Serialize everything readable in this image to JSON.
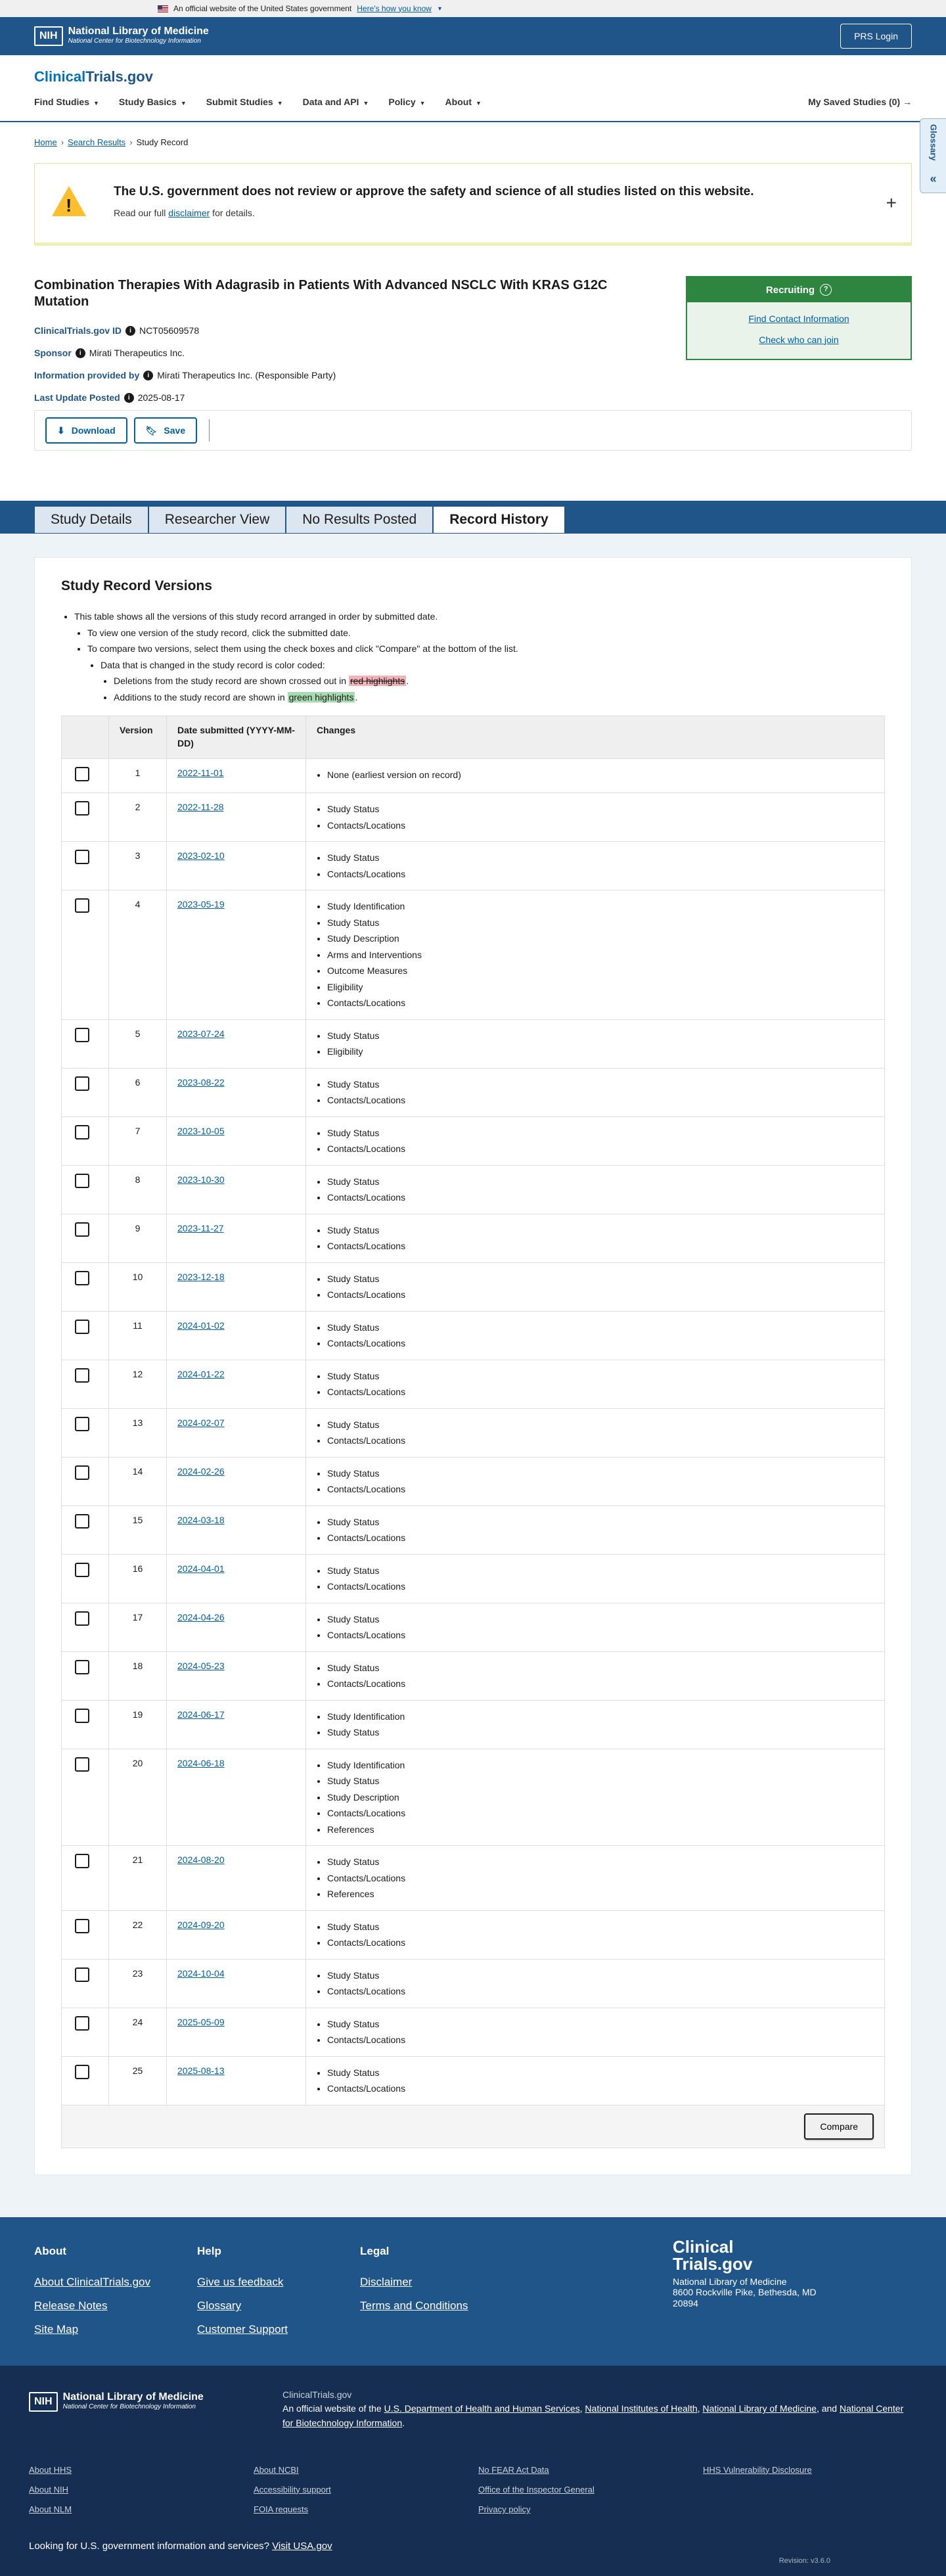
{
  "gov_banner": {
    "text": "An official website of the United States government",
    "link": "Here's how you know"
  },
  "nih": {
    "box": "NIH",
    "name": "National Library of Medicine",
    "sub": "National Center for Biotechnology Information",
    "prs_login": "PRS Login"
  },
  "ct": {
    "logo_a": "Clinical",
    "logo_b": "Trials.gov",
    "nav": [
      "Find Studies",
      "Study Basics",
      "Submit Studies",
      "Data and API",
      "Policy",
      "About"
    ],
    "saved": "My Saved Studies (0) →"
  },
  "breadcrumb": {
    "home": "Home",
    "search": "Search Results",
    "current": "Study Record",
    "sep": "›"
  },
  "glossary": {
    "label": "Glossary",
    "icon": "«"
  },
  "alert": {
    "title": "The U.S. government does not review or approve the safety and science of all studies listed on this website.",
    "text_pre": "Read our full ",
    "link": "disclaimer",
    "text_post": " for details.",
    "expand": "+"
  },
  "study": {
    "title": "Combination Therapies With Adagrasib in Patients With Advanced NSCLC With KRAS G12C Mutation",
    "id_label": "ClinicalTrials.gov ID",
    "id_value": "NCT05609578",
    "sponsor_label": "Sponsor",
    "sponsor_value": "Mirati Therapeutics Inc.",
    "provided_label": "Information provided by",
    "provided_value": "Mirati Therapeutics Inc. (Responsible Party)",
    "updated_label": "Last Update Posted",
    "updated_value": "2025-08-17"
  },
  "status": {
    "label": "Recruiting",
    "icon": "?",
    "link1": "Find Contact Information",
    "link2": "Check who can join"
  },
  "actions": {
    "download": "Download",
    "save": "Save"
  },
  "tabs": [
    "Study Details",
    "Researcher View",
    "No Results Posted",
    "Record History"
  ],
  "versions_section": {
    "heading": "Study Record Versions",
    "b1": "This table shows all the versions of this study record arranged in order by submitted date.",
    "b2": "To view one version of the study record, click the submitted date.",
    "b3": "To compare two versions, select them using the check boxes and click \"Compare\" at the bottom of the list.",
    "b4": "Data that is changed in the study record is color coded:",
    "b5_pre": "Deletions from the study record are shown crossed out in ",
    "b5_hl": "red highlights",
    "b5_post": ".",
    "b6_pre": "Additions to the study record are shown in ",
    "b6_hl": "green highlights",
    "b6_post": ".",
    "col_version": "Version",
    "col_date": "Date submitted (YYYY-MM-DD)",
    "col_changes": "Changes",
    "compare": "Compare"
  },
  "versions": [
    {
      "v": "1",
      "d": "2022-11-01",
      "c": [
        "None (earliest version on record)"
      ]
    },
    {
      "v": "2",
      "d": "2022-11-28",
      "c": [
        "Study Status",
        "Contacts/Locations"
      ]
    },
    {
      "v": "3",
      "d": "2023-02-10",
      "c": [
        "Study Status",
        "Contacts/Locations"
      ]
    },
    {
      "v": "4",
      "d": "2023-05-19",
      "c": [
        "Study Identification",
        "Study Status",
        "Study Description",
        "Arms and Interventions",
        "Outcome Measures",
        "Eligibility",
        "Contacts/Locations"
      ]
    },
    {
      "v": "5",
      "d": "2023-07-24",
      "c": [
        "Study Status",
        "Eligibility"
      ]
    },
    {
      "v": "6",
      "d": "2023-08-22",
      "c": [
        "Study Status",
        "Contacts/Locations"
      ]
    },
    {
      "v": "7",
      "d": "2023-10-05",
      "c": [
        "Study Status",
        "Contacts/Locations"
      ]
    },
    {
      "v": "8",
      "d": "2023-10-30",
      "c": [
        "Study Status",
        "Contacts/Locations"
      ]
    },
    {
      "v": "9",
      "d": "2023-11-27",
      "c": [
        "Study Status",
        "Contacts/Locations"
      ]
    },
    {
      "v": "10",
      "d": "2023-12-18",
      "c": [
        "Study Status",
        "Contacts/Locations"
      ]
    },
    {
      "v": "11",
      "d": "2024-01-02",
      "c": [
        "Study Status",
        "Contacts/Locations"
      ]
    },
    {
      "v": "12",
      "d": "2024-01-22",
      "c": [
        "Study Status",
        "Contacts/Locations"
      ]
    },
    {
      "v": "13",
      "d": "2024-02-07",
      "c": [
        "Study Status",
        "Contacts/Locations"
      ]
    },
    {
      "v": "14",
      "d": "2024-02-26",
      "c": [
        "Study Status",
        "Contacts/Locations"
      ]
    },
    {
      "v": "15",
      "d": "2024-03-18",
      "c": [
        "Study Status",
        "Contacts/Locations"
      ]
    },
    {
      "v": "16",
      "d": "2024-04-01",
      "c": [
        "Study Status",
        "Contacts/Locations"
      ]
    },
    {
      "v": "17",
      "d": "2024-04-26",
      "c": [
        "Study Status",
        "Contacts/Locations"
      ]
    },
    {
      "v": "18",
      "d": "2024-05-23",
      "c": [
        "Study Status",
        "Contacts/Locations"
      ]
    },
    {
      "v": "19",
      "d": "2024-06-17",
      "c": [
        "Study Identification",
        "Study Status"
      ]
    },
    {
      "v": "20",
      "d": "2024-06-18",
      "c": [
        "Study Identification",
        "Study Status",
        "Study Description",
        "Contacts/Locations",
        "References"
      ]
    },
    {
      "v": "21",
      "d": "2024-08-20",
      "c": [
        "Study Status",
        "Contacts/Locations",
        "References"
      ]
    },
    {
      "v": "22",
      "d": "2024-09-20",
      "c": [
        "Study Status",
        "Contacts/Locations"
      ]
    },
    {
      "v": "23",
      "d": "2024-10-04",
      "c": [
        "Study Status",
        "Contacts/Locations"
      ]
    },
    {
      "v": "24",
      "d": "2025-05-09",
      "c": [
        "Study Status",
        "Contacts/Locations"
      ]
    },
    {
      "v": "25",
      "d": "2025-08-13",
      "c": [
        "Study Status",
        "Contacts/Locations"
      ]
    }
  ],
  "footer": {
    "about_h": "About",
    "about": [
      "About ClinicalTrials.gov",
      "Release Notes",
      "Site Map"
    ],
    "help_h": "Help",
    "help": [
      "Give us feedback",
      "Glossary",
      "Customer Support"
    ],
    "legal_h": "Legal",
    "legal": [
      "Disclaimer",
      "Terms and Conditions"
    ],
    "logo_a": "Clinical",
    "logo_b": "Trials.gov",
    "addr1": "National Library of Medicine",
    "addr2": "8600 Rockville Pike, Bethesda, MD 20894",
    "bot_ct": "ClinicalTrials.gov",
    "bot_pre": "An official website of the ",
    "bot_l1": "U.S. Department of Health and Human Services",
    "bot_c1": ", ",
    "bot_l2": "National Institutes of Health",
    "bot_c2": ", ",
    "bot_l3": "National Library of Medicine",
    "bot_c3": ", and ",
    "bot_l4": "National Center for Biotechnology Information",
    "bot_post": ".",
    "links": [
      "About HHS",
      "About NCBI",
      "No FEAR Act Data",
      "HHS Vulnerability Disclosure",
      "About NIH",
      "Accessibility support",
      "Office of the Inspector General",
      "",
      "About NLM",
      "FOIA requests",
      "Privacy policy",
      ""
    ],
    "gov_q": "Looking for U.S. government information and services?",
    "gov_link": "Visit USA.gov",
    "revision": "Revision: v3.6.0"
  }
}
